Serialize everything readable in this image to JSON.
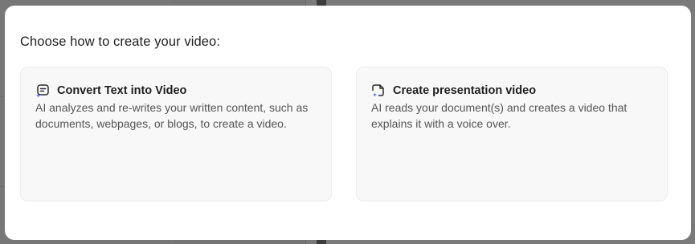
{
  "modal": {
    "title": "Choose how to create your video:",
    "options": [
      {
        "title": "Convert Text into Video",
        "description": "AI analyzes and re-writes your written content, such as documents, webpages, or blogs, to create a video.",
        "icon": "text-to-video-icon"
      },
      {
        "title": "Create presentation video",
        "description": "AI reads your document(s) and creates a video that explains it with a voice over.",
        "icon": "presentation-video-icon"
      }
    ]
  },
  "colors": {
    "overlay": "#777777",
    "modal_bg": "#ffffff",
    "card_bg": "#f8f8f8",
    "card_border": "#ececec",
    "title_text": "#1f1f1f",
    "desc_text": "#555555",
    "icon_accent": "#5b6cf0"
  }
}
